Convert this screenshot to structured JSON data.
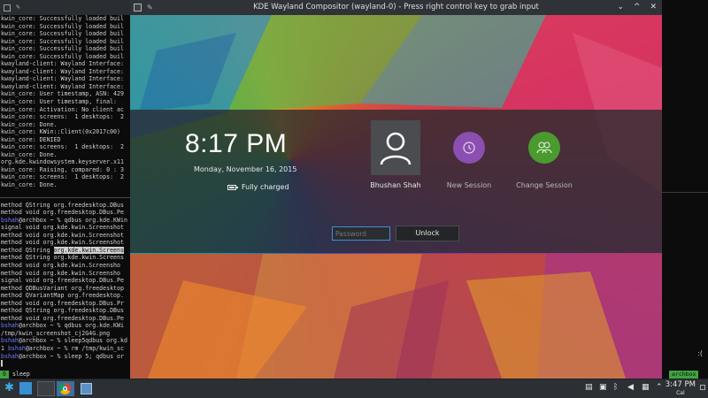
{
  "terminal": {
    "top_lines": [
      "kwin_core: Successfully loaded buil",
      "kwin_core: Successfully loaded buil",
      "kwin_core: Successfully loaded buil",
      "kwin_core: Successfully loaded buil",
      "kwin_core: Successfully loaded buil",
      "kwin_core: Successfully loaded buil",
      "kwayland-client: Wayland Interface:",
      "kwayland-client: Wayland Interface:",
      "kwayland-client: Wayland Interface:",
      "kwayland-client: Wayland Interface:",
      "kwin_core: User timestamp, ASN: 429",
      "kwin_core: User timestamp, final: ",
      "kwin_core: Activation: No client ac",
      "kwin_core: screens:  1 desktops:  2",
      "kwin_core: Done.",
      "kwin_core: KWin::Client(0x2017c00)",
      "kwin_core: DENIED",
      "kwin_core: screens:  1 desktops:  2",
      "kwin_core: Done.",
      "org.kde.kwindowsystem.keyserver.x11",
      "kwin_core: Raising, compared: 0 : 3",
      "kwin_core: screens:  1 desktops:  2",
      "kwin_core: Done."
    ],
    "bottom_lines": [
      "method QString org.freedesktop.DBus",
      "method void org.freedesktop.DBus.Pe",
      "{user}@archbox ~ % qdbus org.kde.KWin",
      "signal void org.kde.kwin.Screenshot",
      "method void org.kde.kwin.Screenshot",
      "method void org.kde.kwin.Screenshot",
      "method QString {hl}org.kde.kwin.Screens{/hl}",
      "method QString org.kde.kwin.Screens",
      "method void org.kde.kwin.Screensho",
      "method void org.kde.kwin.Screensho",
      "signal void org.freedesktop.DBus.Pe",
      "method QDBusVariant org.freedesktop",
      "method QVariantMap org.freedesktop.",
      "method void org.freedesktop.DBus.Pr",
      "method QString org.freedesktop.DBus",
      "method void org.freedesktop.DBus.Pe",
      "{user}@archbox ~ % qdbus org.kde.KWi",
      "/tmp/kwin_screenshot_cj2G4G.png",
      "{user}@archbox ~ % sleep5qdbus org.kd",
      "1 {user}@archbox ~ % rm /tmp/kwin_sc",
      "{user}@archbox ~ % sleep 5; qdbus or",
      "▌"
    ],
    "prompt_user": "bshah",
    "status_window_number": "0",
    "status_window_name": "sleep"
  },
  "right_strip": {
    "host_tag": "archbox",
    "dots": ":("
  },
  "kwin": {
    "title": "KDE Wayland Compositor (wayland-0) - Press right control key to grab input",
    "controls": [
      "⌄",
      "^",
      "✕"
    ]
  },
  "lock_screen": {
    "time": "8:17 PM",
    "date": "Monday, November 16, 2015",
    "battery_status": "Fully charged",
    "users": [
      {
        "label": "Bhushan Shah",
        "icon": "user-avatar-icon"
      },
      {
        "label": "New Session",
        "icon": "new-session-icon"
      },
      {
        "label": "Change Session",
        "icon": "change-session-icon"
      }
    ],
    "password_placeholder": "Password",
    "unlock_label": "Unlock"
  },
  "taskbar": {
    "clock_time": "3:47 PM",
    "clock_date": "Cal"
  },
  "colors": {
    "accent": "#3f8fd8",
    "new_session": "#8a4fb0",
    "change_session": "#4b9a2f",
    "tmux_green": "#3fa33f"
  }
}
